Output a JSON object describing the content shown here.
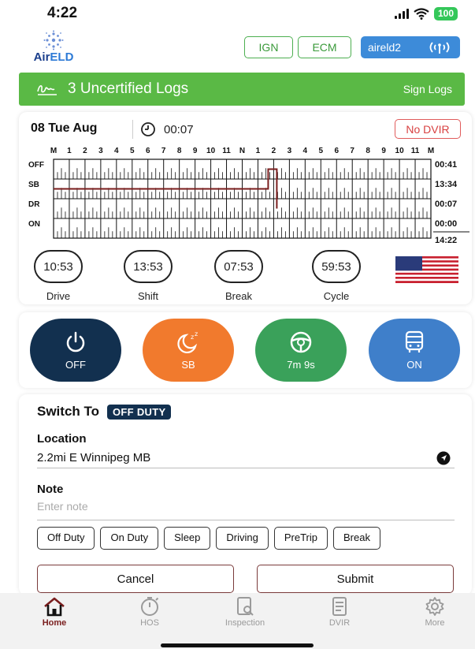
{
  "status_bar": {
    "time": "4:22",
    "battery": "100"
  },
  "header": {
    "logo_text_a": "Air",
    "logo_text_b": "ELD",
    "ign_label": "IGN",
    "ecm_label": "ECM",
    "device_label": "aireld2",
    "device_icon": "broadcast-icon"
  },
  "banner": {
    "title": "3 Uncertified Logs",
    "action": "Sign Logs",
    "color": "#5ab945"
  },
  "log": {
    "date": "08 Tue Aug",
    "clock_value": "00:07",
    "no_dvir_label": "No DVIR",
    "hour_labels": [
      "M",
      "1",
      "2",
      "3",
      "4",
      "5",
      "6",
      "7",
      "8",
      "9",
      "10",
      "11",
      "N",
      "1",
      "2",
      "3",
      "4",
      "5",
      "6",
      "7",
      "8",
      "9",
      "10",
      "11",
      "M"
    ],
    "rows": [
      {
        "label": "OFF",
        "total": "00:41"
      },
      {
        "label": "SB",
        "total": "13:34"
      },
      {
        "label": "DR",
        "total": "00:07"
      },
      {
        "label": "ON",
        "total": "00:00"
      }
    ],
    "grand_total": "14:22"
  },
  "timers": [
    {
      "value": "10:53",
      "label": "Drive"
    },
    {
      "value": "13:53",
      "label": "Shift"
    },
    {
      "value": "07:53",
      "label": "Break"
    },
    {
      "value": "59:53",
      "label": "Cycle"
    }
  ],
  "status_buttons": [
    {
      "label": "OFF",
      "icon": "power-icon",
      "color": "#12304f"
    },
    {
      "label": "SB",
      "icon": "sleep-moon-icon",
      "color": "#f17a2d"
    },
    {
      "label": "7m 9s",
      "icon": "steering-wheel-icon",
      "color": "#3aa15a"
    },
    {
      "label": "ON",
      "icon": "bus-icon",
      "color": "#3f7fca"
    }
  ],
  "form": {
    "switch_label": "Switch To",
    "switch_status": "OFF DUTY",
    "location_label": "Location",
    "location_value": "2.2mi E Winnipeg MB",
    "note_label": "Note",
    "note_placeholder": "Enter note",
    "chips": [
      "Off Duty",
      "On Duty",
      "Sleep",
      "Driving",
      "PreTrip",
      "Break"
    ],
    "cancel_label": "Cancel",
    "submit_label": "Submit"
  },
  "nav": [
    {
      "label": "Home",
      "icon": "home-icon",
      "active": true
    },
    {
      "label": "HOS",
      "icon": "stopwatch-icon",
      "active": false
    },
    {
      "label": "Inspection",
      "icon": "inspection-icon",
      "active": false
    },
    {
      "label": "DVIR",
      "icon": "document-icon",
      "active": false
    },
    {
      "label": "More",
      "icon": "gear-icon",
      "active": false
    }
  ]
}
